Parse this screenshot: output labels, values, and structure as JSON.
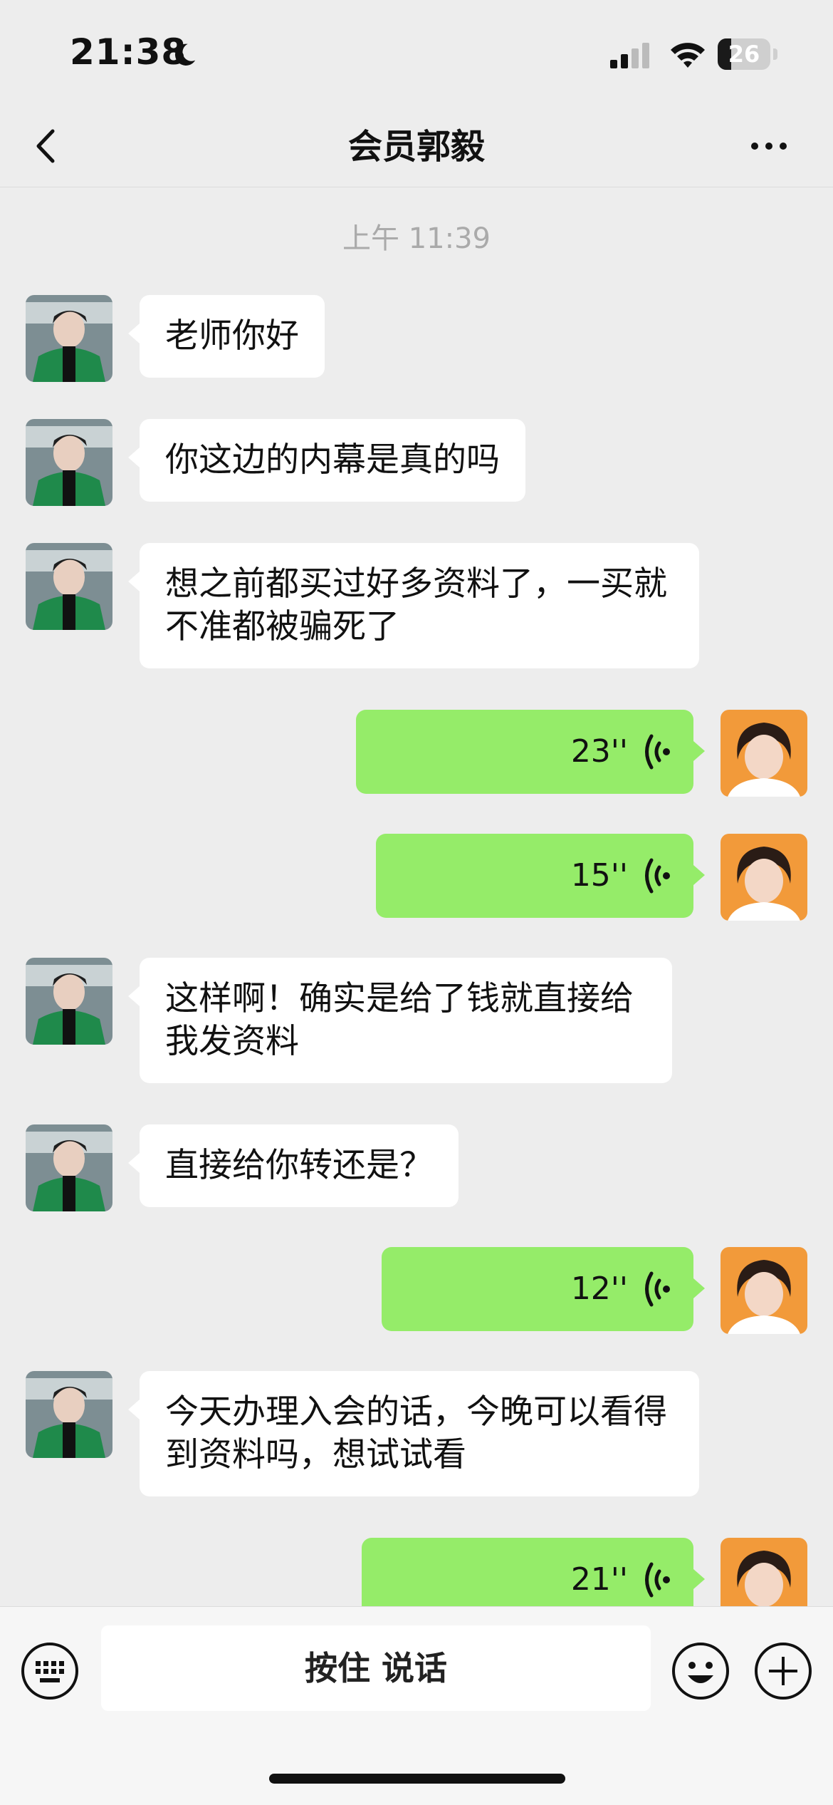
{
  "status_bar": {
    "time": "21:38",
    "battery": "26",
    "battery_level": 0.26
  },
  "header": {
    "title": "会员郭毅"
  },
  "chat": {
    "timestamp": "上午 11:39",
    "messages": [
      {
        "side": "in",
        "type": "text",
        "text": "老师你好"
      },
      {
        "side": "in",
        "type": "text",
        "text": "你这边的内幕是真的吗"
      },
      {
        "side": "in",
        "type": "text",
        "text": "想之前都买过好多资料了，一买就不准都被骗死了"
      },
      {
        "side": "out",
        "type": "voice",
        "duration": "23''"
      },
      {
        "side": "out",
        "type": "voice",
        "duration": "15''"
      },
      {
        "side": "in",
        "type": "text",
        "text": "这样啊！确实是给了钱就直接给我发资料"
      },
      {
        "side": "in",
        "type": "text",
        "text": "直接给你转还是？"
      },
      {
        "side": "out",
        "type": "voice",
        "duration": "12''"
      },
      {
        "side": "in",
        "type": "text",
        "text": "今天办理入会的话，今晚可以看得到资料吗，想试试看"
      },
      {
        "side": "out",
        "type": "voice",
        "duration": "21''"
      }
    ]
  },
  "input_bar": {
    "hold_to_talk": "按住 说话"
  },
  "colors": {
    "background": "#EDEDED",
    "outgoing_bubble": "#95EC69",
    "incoming_bubble": "#FFFFFF"
  },
  "icons": [
    "moon-icon",
    "signal-icon",
    "wifi-icon",
    "battery-icon",
    "back-icon",
    "more-icon",
    "keyboard-icon",
    "emoji-icon",
    "plus-icon",
    "voice-icon"
  ]
}
